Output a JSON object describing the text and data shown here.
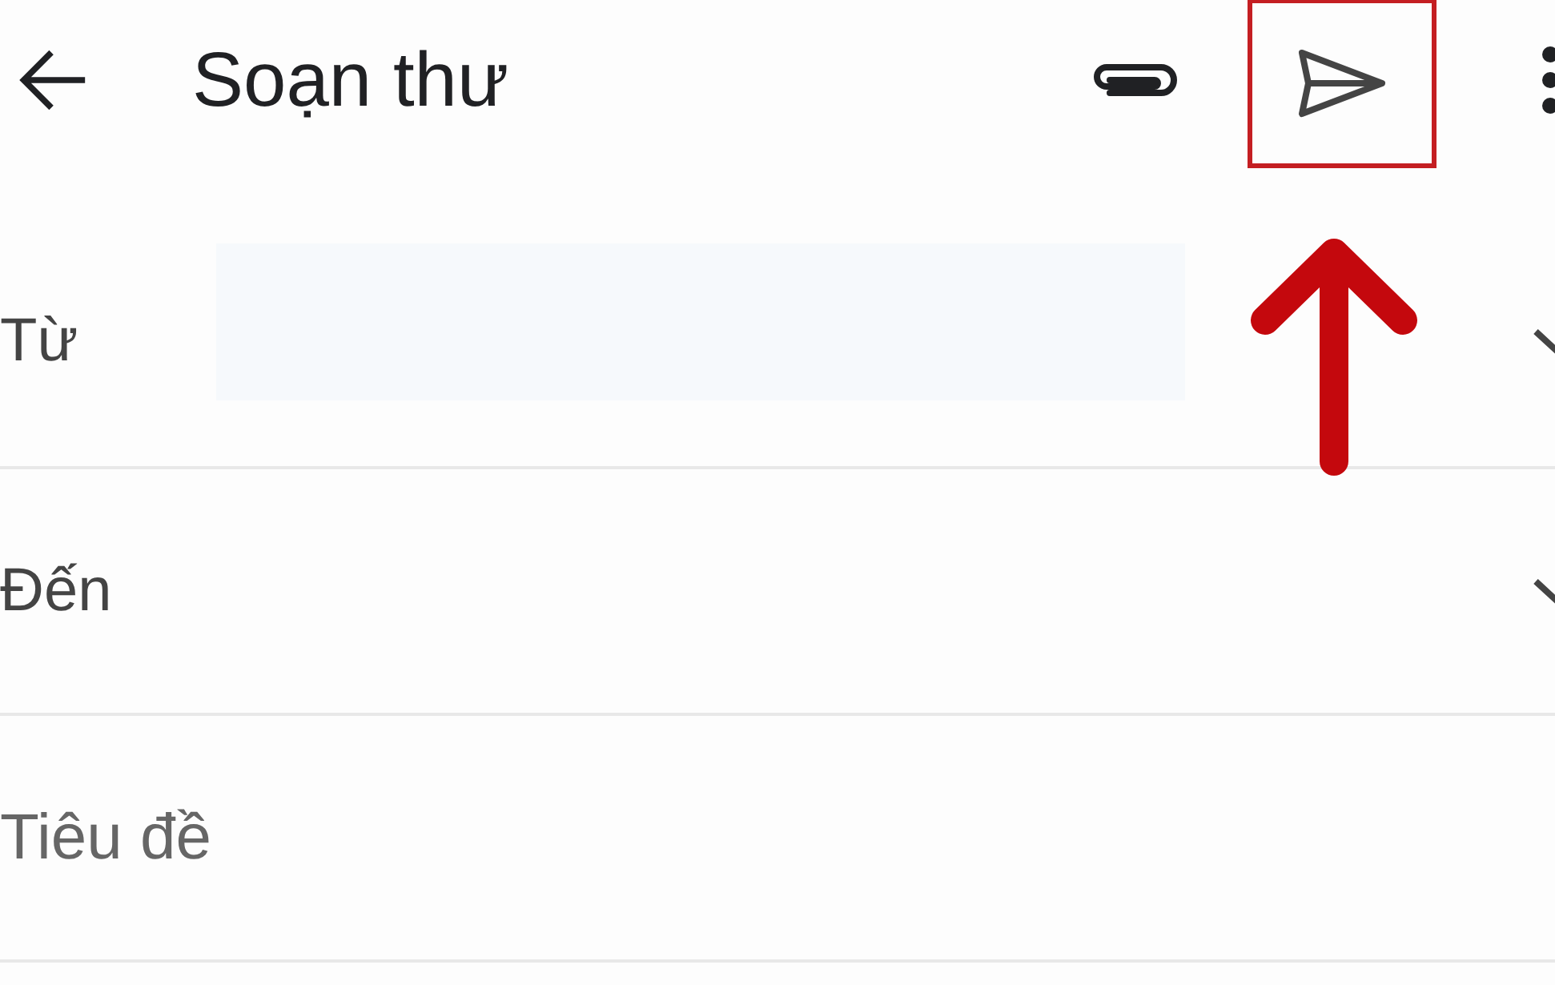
{
  "app_bar": {
    "title": "Soạn thư",
    "actions": [
      {
        "kind": "attach",
        "highlighted": false
      },
      {
        "kind": "send",
        "highlighted": true
      },
      {
        "kind": "more",
        "highlighted": false
      }
    ]
  },
  "fields": [
    {
      "kind": "from",
      "label": "Từ",
      "redacted": true,
      "dropdown": true
    },
    {
      "kind": "to",
      "label": "Đến",
      "dropdown": true
    },
    {
      "kind": "subject",
      "placeholder": "Tiêu đề"
    }
  ]
}
